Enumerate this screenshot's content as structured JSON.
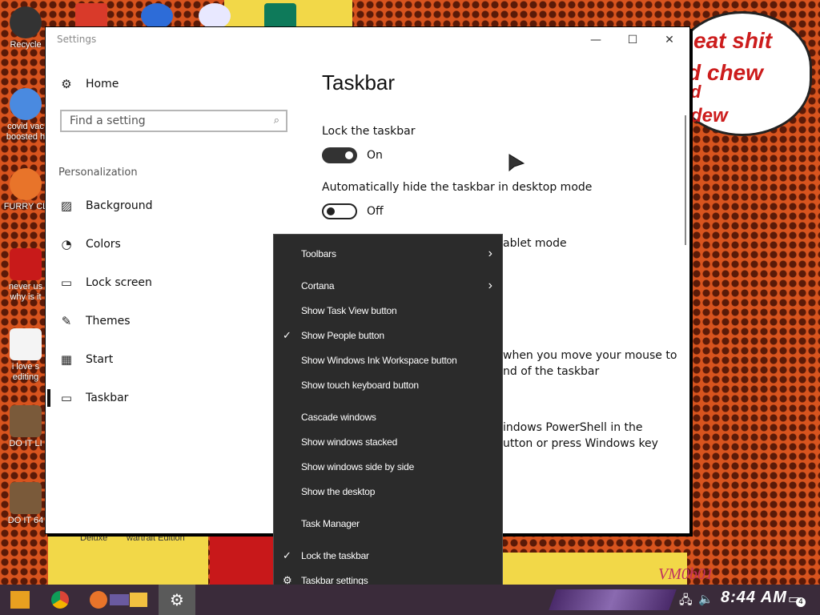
{
  "desktop": {
    "top_icons": [
      {
        "name": "pdf-app-icon",
        "color": "#d93a2a"
      },
      {
        "name": "maps-app-icon",
        "color": "#2d6cd8"
      },
      {
        "name": "browser-app-icon",
        "color": "#e8e8ff"
      },
      {
        "name": "publisher-app-icon",
        "color": "#0e7a5a"
      }
    ],
    "left_icons": [
      {
        "label": "Recycle",
        "color": "#333"
      },
      {
        "label": "covid vac",
        "label2": "boosted h",
        "color": "#4a8ae0"
      },
      {
        "label": "FURRY CL",
        "color": "#e8742a"
      },
      {
        "label": "never us",
        "label2": "why is it",
        "color": "#c81a1a"
      },
      {
        "label": "i love s",
        "label2": "editing",
        "color": "#f4f4f4"
      },
      {
        "label": "DO IT LI",
        "color": "#7a5a3a"
      },
      {
        "label": "DO IT 64",
        "color": "#7a5a3a"
      }
    ],
    "bubble_lines": [
      "eat shit",
      "d chew",
      "d",
      "dew"
    ],
    "art_captions": [
      "Deluxe",
      "wartrait Edition",
      "VM0b01"
    ]
  },
  "window": {
    "title": "Settings",
    "controls": {
      "minimize": "—",
      "maximize": "☐",
      "close": "✕"
    }
  },
  "sidebar": {
    "home_label": "Home",
    "search_placeholder": "Find a setting",
    "section": "Personalization",
    "items": [
      {
        "label": "Background",
        "icon": "image-icon",
        "glyph": "🖼"
      },
      {
        "label": "Colors",
        "icon": "palette-icon",
        "glyph": "🎨"
      },
      {
        "label": "Lock screen",
        "icon": "lock-screen-icon",
        "glyph": "▭"
      },
      {
        "label": "Themes",
        "icon": "themes-icon",
        "glyph": "✎"
      },
      {
        "label": "Start",
        "icon": "start-icon",
        "glyph": "▦"
      },
      {
        "label": "Taskbar",
        "icon": "taskbar-icon",
        "glyph": "▭"
      }
    ],
    "selected": "Taskbar"
  },
  "main": {
    "title": "Taskbar",
    "settings": [
      {
        "label": "Lock the taskbar",
        "state": "On"
      },
      {
        "label": "Automatically hide the taskbar in desktop mode",
        "state": "Off"
      }
    ],
    "partial_texts": [
      "ablet mode",
      "when you move your mouse to",
      "nd of the taskbar",
      "indows PowerShell in the",
      "utton or press Windows key"
    ]
  },
  "context_menu": {
    "items": [
      {
        "label": "Toolbars",
        "submenu": true
      },
      {
        "label": "Cortana",
        "submenu": true
      },
      {
        "label": "Show Task View button"
      },
      {
        "label": "Show People button",
        "checked": true
      },
      {
        "label": "Show Windows Ink Workspace button"
      },
      {
        "label": "Show touch keyboard button"
      },
      {
        "label": "Cascade windows"
      },
      {
        "label": "Show windows stacked"
      },
      {
        "label": "Show windows side by side"
      },
      {
        "label": "Show the desktop"
      },
      {
        "label": "Task Manager"
      },
      {
        "label": "Lock the taskbar",
        "checked": true
      },
      {
        "label": "Taskbar settings",
        "gear": true
      }
    ],
    "check_glyph": "✓",
    "arrow_glyph": "›",
    "gear_glyph": "⚙"
  },
  "taskbar": {
    "clock": "8:44 AM",
    "notification_badge": "4",
    "pinned": [
      "start-button",
      "chrome-icon",
      "firefox-icon",
      "task-view-icon",
      "file-explorer-icon",
      "settings-icon"
    ]
  }
}
